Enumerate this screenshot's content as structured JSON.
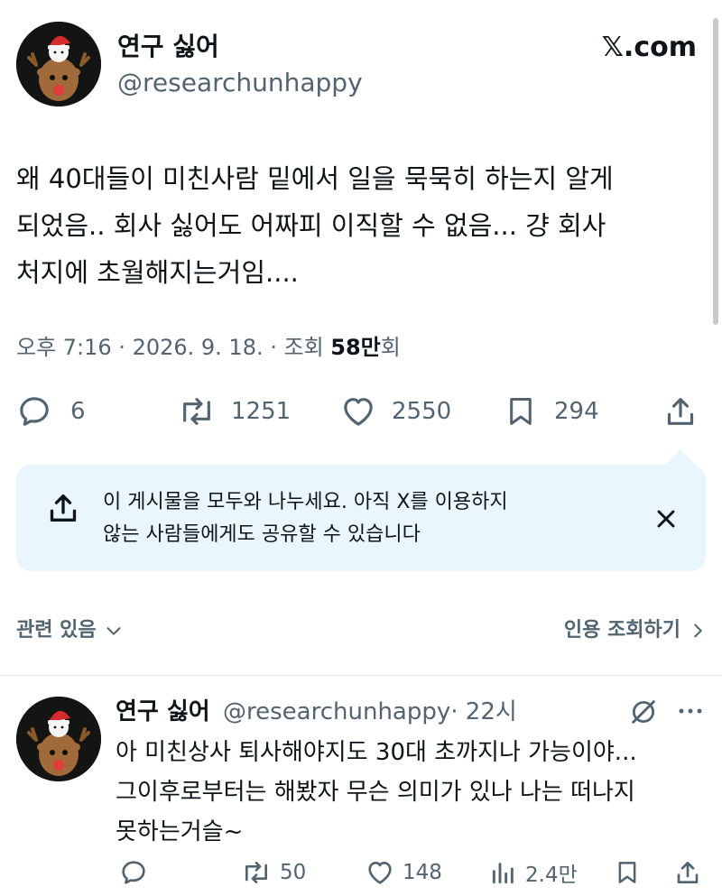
{
  "main_post": {
    "author_name": "연구 싫어",
    "handle": "@researchunhappy",
    "site_logo": "𝕏.com",
    "text_lines": [
      "왜 40대들이 미친사람 밑에서 일을 묵묵히 하는지 알게",
      "되었음.. 회사 싫어도 어짜피 이직할 수 없음... 걍 회사",
      "처지에 초월해지는거임...."
    ],
    "meta_prefix": "오후 7:16 · 2026. 9. 18. · 조회 ",
    "views_bold": "58만",
    "views_suffix": "회",
    "actions": {
      "replies": "6",
      "reposts": "1251",
      "likes": "2550",
      "bookmarks": "294"
    }
  },
  "share_banner": {
    "line1": "이 게시물을 모두와 나누세요. 아직 X를 이용하지",
    "line2": "않는 사람들에게도 공유할 수 있습니다"
  },
  "footer_links": {
    "related": "관련 있음",
    "quotes": "인용 조회하기"
  },
  "reply_post": {
    "author_name": "연구 싫어",
    "handle": "@researchunhappy",
    "time": "· 22시",
    "text_lines": [
      "아 미친상사 퇴사해야지도 30대 초까지나 가능이야...",
      "그이후로부터는 해봤자 무슨 의미가 있나 나는 떠나지",
      "못하는거슬~"
    ],
    "actions": {
      "reposts": "50",
      "likes": "148",
      "views": "2.4만"
    }
  },
  "colors": {
    "text": "#0f1419",
    "muted": "#536471",
    "banner_bg": "#eaf6fd"
  }
}
